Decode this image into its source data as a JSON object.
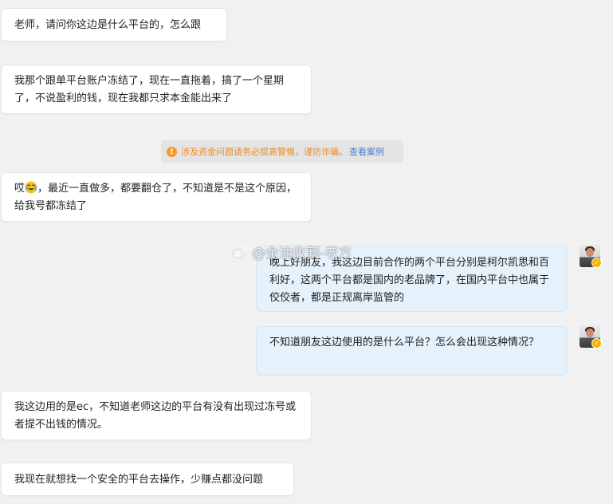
{
  "messages": {
    "m1": "老师，请问你这边是什么平台的，怎么跟",
    "m2": "我那个跟单平台账户冻结了，现在一直拖着，搞了一个星期了，不说盈利的钱，现在我都只求本金能出来了",
    "m3_before_emoji": "哎",
    "m3_after_emoji": "，最近一直做多，都要翻仓了，不知道是不是这个原因，给我号都冻结了",
    "m4": "晚上好朋友，我这边目前合作的两个平台分别是柯尔凯思和百利好，这两个平台都是国内的老品牌了，在国内平台中也属于佼佼者，都是正规离岸监管的",
    "m5": "不知道朋友这边使用的是什么平台？怎么会出现这种情况？",
    "m6": "我这边用的是ec，不知道老师这边的平台有没有出现过冻号或者提不出钱的情况。",
    "m7": "我现在就想找一个安全的平台去操作，少赚点都没问题"
  },
  "notice": {
    "icon": "!",
    "text": "涉及资金问题请务必提高警惕，谨防诈骗。",
    "link": "查看案例"
  },
  "watermark": {
    "text": "@金油收割-老方"
  },
  "icons": {
    "notice": "info-icon",
    "emoji": "laughing-tears-emoji",
    "avatar": "advisor-avatar",
    "badge": "verified-badge-icon",
    "watermark": "weibo-icon"
  },
  "colors": {
    "background": "#f1f1f1",
    "incoming_bubble": "#ffffff",
    "outgoing_bubble": "#e5f1fb",
    "warning": "#f08a24",
    "link": "#4a7bd0",
    "badge": "#f5b400"
  }
}
